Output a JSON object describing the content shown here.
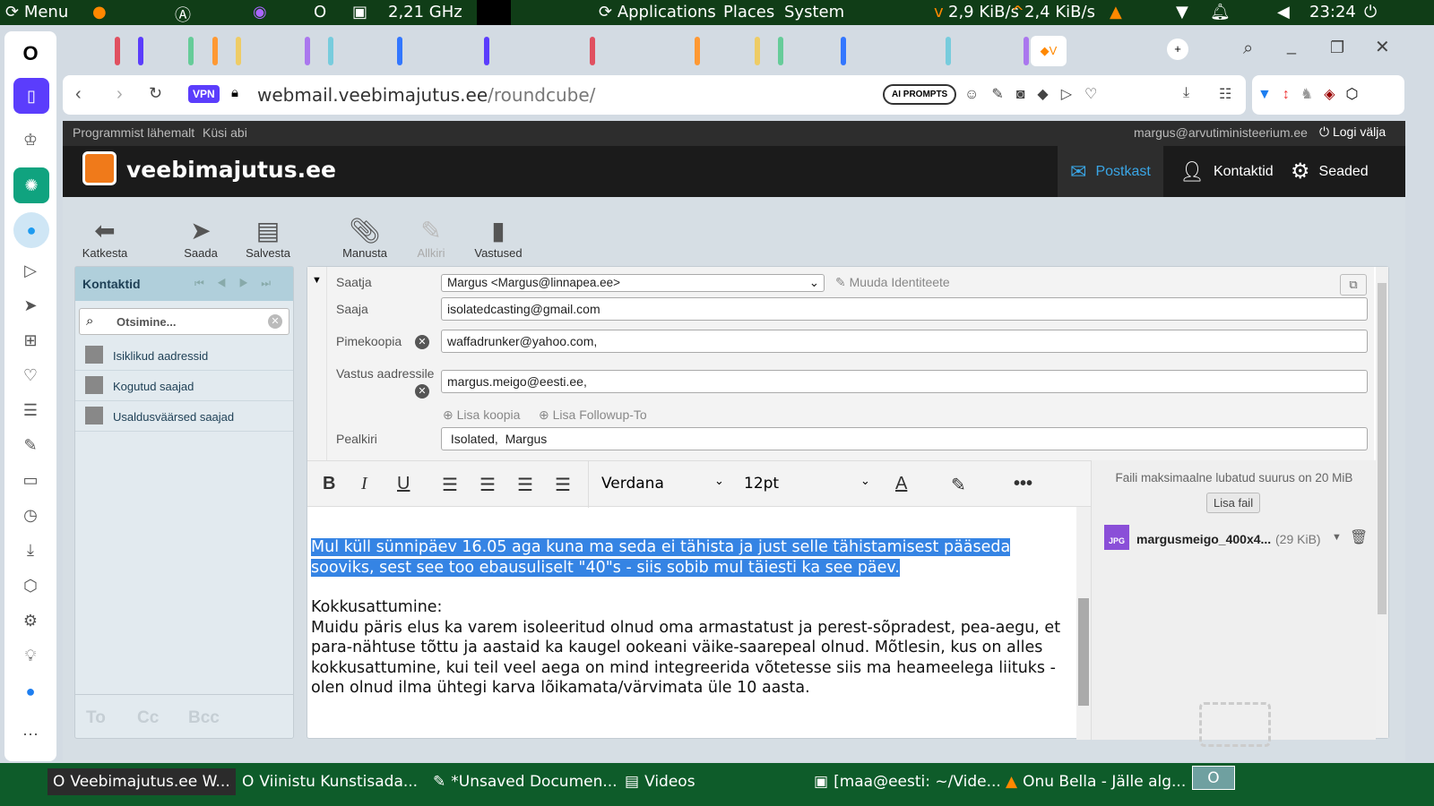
{
  "system_panel": {
    "menu": "Menu",
    "cpu": "2,21 GHz",
    "applications": "Applications",
    "places": "Places",
    "system": "System",
    "net_down": "2,9 KiB/s",
    "net_up": "2,4 KiB/s",
    "clock": "23:24"
  },
  "browser": {
    "url_domain": "webmail.veebimajutus.ee",
    "url_path": "/roundcube/",
    "vpn": "VPN",
    "ai_prompts": "AI PROMPTS"
  },
  "roundcube": {
    "top_links": [
      "Programmist lähemalt",
      "Küsi abi"
    ],
    "user": "margus@arvutiministeerium.ee",
    "logout": "Logi välja",
    "logo": "veebimajutus.ee",
    "nav": [
      {
        "label": "Postkast"
      },
      {
        "label": "Kontaktid"
      },
      {
        "label": "Seaded"
      }
    ],
    "toolbar": [
      {
        "label": "Katkesta"
      },
      {
        "label": "Saada"
      },
      {
        "label": "Salvesta"
      },
      {
        "label": "Manusta"
      },
      {
        "label": "Allkiri"
      },
      {
        "label": "Vastused"
      }
    ],
    "contacts": {
      "title": "Kontaktid",
      "search_placeholder": "Otsimine...",
      "groups": [
        "Isiklikud aadressid",
        "Kogutud saajad",
        "Usaldusväärsed saajad"
      ],
      "footer": [
        "To",
        "Cc",
        "Bcc"
      ]
    },
    "compose": {
      "from_label": "Saatja",
      "from_value": "Margus <Margus@linnapea.ee>",
      "edit_identity": "Muuda Identiteete",
      "to_label": "Saaja",
      "to_value": "isolatedcasting@gmail.com",
      "bcc_label": "Pimekoopia",
      "bcc_value": "waffadrunker@yahoo.com,",
      "replyto_label": "Vastus aadressile",
      "replyto_value": "margus.meigo@eesti.ee,",
      "add_cc": "Lisa koopia",
      "add_followup": "Lisa Followup-To",
      "subject_label": "Pealkiri",
      "subject_value": " Isolated,  Margus",
      "font": "Verdana",
      "size": "12pt",
      "body_selected": "Mul küll sünnipäev 16.05 aga kuna ma seda ei tähista ja just selle tähistamisest pääseda sooviks, sest see too ebausuliselt \"40\"s - siis sobib mul täiesti ka see päev.",
      "body_heading": "Kokkusattumine:",
      "body_text": "Muidu päris elus ka  varem isoleeritud olnud oma armastatust ja perest-sõpradest, pea-aegu, et para-nähtuse tõttu ja aastaid ka kaugel ookeani väike-saarepeal olnud. Mõtlesin, kus on alles kokkusattumine, kui teil veel aega on mind integreerida võtetesse siis ma heameelega liituks - olen olnud ilma ühtegi karva lõikamata/värvimata üle 10 aasta."
    },
    "attachments": {
      "max_size": "Faili maksimaalne lubatud suurus on 20 MiB",
      "add_file": "Lisa fail",
      "file_name": "margusmeigo_400x4...",
      "file_size": "(29 KiB)",
      "file_type": "JPG"
    }
  },
  "taskbar": [
    "Veebimajutus.ee W...",
    "Viinistu Kunstisada...",
    "*Unsaved Documen...",
    "Videos",
    "[maa@eesti: ~/Vide...",
    "Onu Bella - Jälle alg..."
  ],
  "colors": {
    "accent": "#3584e4",
    "header": "#1b1b1b",
    "panel": "#103d17",
    "taskbar": "#0e5c2a"
  }
}
